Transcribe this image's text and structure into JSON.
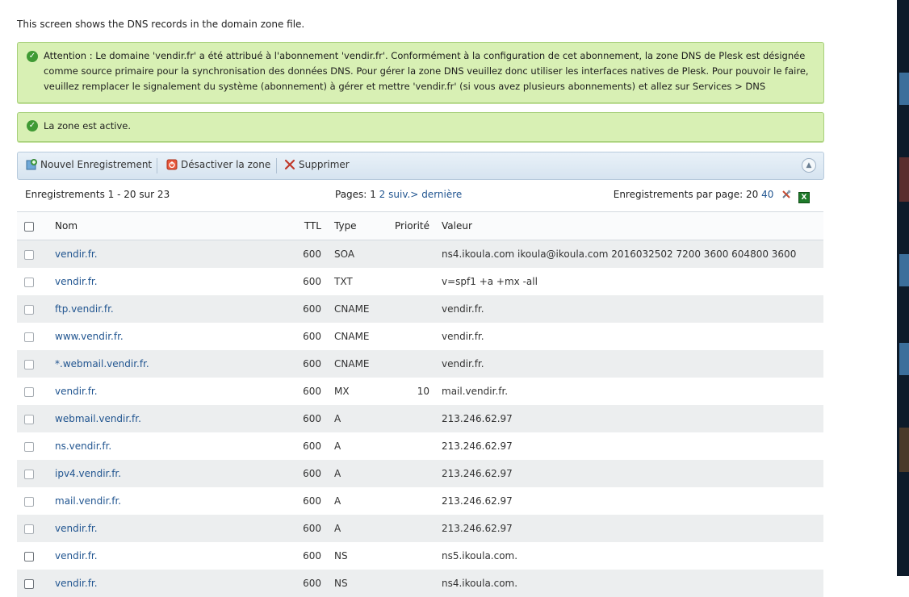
{
  "intro_text": "This screen shows the DNS records in the domain zone file.",
  "messages": [
    {
      "text": "Attention : Le domaine 'vendir.fr' a été attribué à l'abonnement 'vendir.fr'. Conformément à la configuration de cet abonnement, la zone DNS de Plesk est désignée comme source primaire pour la synchronisation des données DNS. Pour gérer la zone DNS veuillez donc utiliser les interfaces natives de Plesk. Pour pouvoir le faire, veuillez remplacer le signalement du système (abonnement) à gérer et mettre 'vendir.fr' (si vous avez plusieurs abonnements) et allez sur Services > DNS"
    },
    {
      "text": "La zone est active."
    }
  ],
  "toolbar": {
    "new_record": "Nouvel Enregistrement",
    "disable_zone": "Désactiver la zone",
    "delete": "Supprimer"
  },
  "pager": {
    "records_info": "Enregistrements 1 - 20 sur 23",
    "pages_label": "Pages:",
    "current_page": "1",
    "page_2": "2",
    "next": "suiv.>",
    "last": "dernière",
    "per_page_label": "Enregistrements par page:",
    "per_page_current": "20",
    "per_page_option": "40"
  },
  "table": {
    "headers": {
      "name": "Nom",
      "ttl": "TTL",
      "type": "Type",
      "priority": "Priorité",
      "value": "Valeur"
    },
    "rows": [
      {
        "name": "vendir.fr.",
        "ttl": "600",
        "type": "SOA",
        "priority": "",
        "value": "ns4.ikoula.com ikoula@ikoula.com 2016032502 7200 3600 604800 3600"
      },
      {
        "name": "vendir.fr.",
        "ttl": "600",
        "type": "TXT",
        "priority": "",
        "value": "v=spf1 +a +mx -all"
      },
      {
        "name": "ftp.vendir.fr.",
        "ttl": "600",
        "type": "CNAME",
        "priority": "",
        "value": "vendir.fr."
      },
      {
        "name": "www.vendir.fr.",
        "ttl": "600",
        "type": "CNAME",
        "priority": "",
        "value": "vendir.fr."
      },
      {
        "name": "*.webmail.vendir.fr.",
        "ttl": "600",
        "type": "CNAME",
        "priority": "",
        "value": "vendir.fr."
      },
      {
        "name": "vendir.fr.",
        "ttl": "600",
        "type": "MX",
        "priority": "10",
        "value": "mail.vendir.fr."
      },
      {
        "name": "webmail.vendir.fr.",
        "ttl": "600",
        "type": "A",
        "priority": "",
        "value": "213.246.62.97"
      },
      {
        "name": "ns.vendir.fr.",
        "ttl": "600",
        "type": "A",
        "priority": "",
        "value": "213.246.62.97"
      },
      {
        "name": "ipv4.vendir.fr.",
        "ttl": "600",
        "type": "A",
        "priority": "",
        "value": "213.246.62.97"
      },
      {
        "name": "mail.vendir.fr.",
        "ttl": "600",
        "type": "A",
        "priority": "",
        "value": "213.246.62.97"
      },
      {
        "name": "vendir.fr.",
        "ttl": "600",
        "type": "A",
        "priority": "",
        "value": "213.246.62.97"
      },
      {
        "name": "vendir.fr.",
        "ttl": "600",
        "type": "NS",
        "priority": "",
        "value": "ns5.ikoula.com."
      },
      {
        "name": "vendir.fr.",
        "ttl": "600",
        "type": "NS",
        "priority": "",
        "value": "ns4.ikoula.com."
      }
    ]
  },
  "colors": {
    "success_bg": "#d8f0b4",
    "link": "#215590",
    "toolbar_bg": "#dde8f2"
  }
}
